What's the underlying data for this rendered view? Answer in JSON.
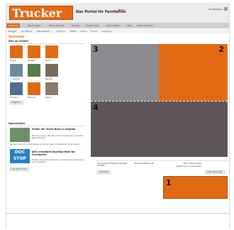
{
  "header": {
    "logo_text": "Trucker",
    "tagline": "Das Portal für Fernfahrer",
    "beta_badge": "BETA",
    "login_label": "Mediatheker |"
  },
  "nav": {
    "items": [
      "Startseite",
      "Nachrichten",
      "Test & Technik",
      "Service",
      "Trucker-Club",
      "Autoverkauf",
      "Shop",
      "Label & Events"
    ]
  },
  "subnav": {
    "items": [
      "Blogger",
      "Fernfahrer",
      "Werkstätten",
      "Termine",
      "Bilder",
      "Videos",
      "Forum",
      "Umfragen"
    ]
  },
  "page_title": "Startseite",
  "members_box": {
    "title": "Wer ist online?",
    "members": [
      {
        "name": "Bruder"
      },
      {
        "name": "Kapitän..."
      },
      {
        "name": "Nicole"
      },
      {
        "name": "..."
      },
      {
        "name": "Kapitän..."
      },
      {
        "name": "..."
      },
      {
        "name": "...onskoelli"
      },
      {
        "name": "..."
      },
      {
        "name": "Kapitän..."
      },
      {
        "name": "Trucker1..."
      },
      {
        "name": "Burtener"
      },
      {
        "name": "Georg..."
      }
    ],
    "more_button": "Mitglieder"
  },
  "news_box": {
    "title": "Nachrichten",
    "item1_title": "Pixels der Truck-Race in Gnalom",
    "item1_text": "Pirt kann is over. Mit oben well der personen na Gnalom Bewandordnier",
    "item1_more": "gering un eine Hochstein Reisia Anneding, geworn Bewaherer heldt Abweis.",
    "item2_logo": "DOC STOP",
    "item2_title": "DKV erweitert DocStop-Netz für Fernfahrer",
    "item2_text": "Erstand. Das Partner-Netz zur medizinischen Versorgung wird ausgebaut.",
    "more_button": "Alle Nachrichten"
  },
  "lower": {
    "col1_text": "DKV GESCHÄFTSKREIS TRUCKER POSTEN",
    "col1_more": "Alle Bilder",
    "col2_text": "Klimawerkstättennetz",
    "col3_text": "Bild 1 abhilfe Akten",
    "col3_sub": "Bewertung von Lkw-Lasten",
    "col3_btn": "Links übertragen"
  },
  "overlays": {
    "block1_label": "1",
    "block2_label": "2",
    "block3_label": "3",
    "block4_label": "4"
  },
  "colors": {
    "accent_orange": "#e36a14",
    "gray_block": "#8a8b91",
    "dark_block": "#5e5558"
  }
}
